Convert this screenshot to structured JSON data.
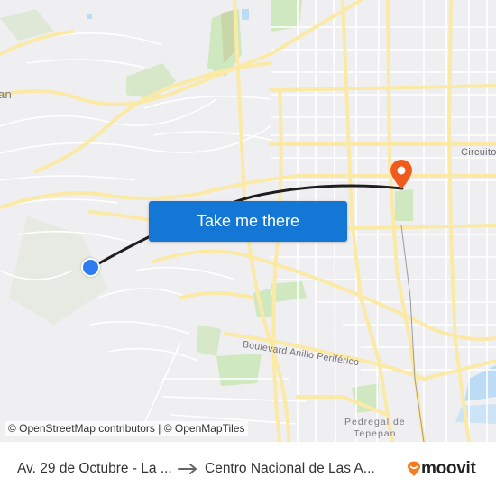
{
  "map": {
    "labels": {
      "circuito": "Circuito",
      "periferico": "Boulevard Anillo Periférico",
      "pedregal_line1": "Pedregal de",
      "pedregal_line2": "Tepepan",
      "partial_place": "an"
    },
    "colors": {
      "background": "#efeff1",
      "road": "#fbe9a6",
      "minor_road": "#ffffff",
      "park": "#cfe8c0",
      "water": "#bcdcf5",
      "route": "#222222",
      "origin_dot": "#2f7bf0",
      "destination_pin": "#f05a1c",
      "button": "#1477d5"
    }
  },
  "cta": {
    "label": "Take me there"
  },
  "markers": {
    "origin_icon": "origin-dot",
    "destination_icon": "map-pin"
  },
  "attribution": {
    "osm": "© OpenStreetMap contributors",
    "separator": " | ",
    "omt": "© OpenMapTiles"
  },
  "footer": {
    "origin": "Av. 29 de Octubre - La ...",
    "arrow_icon": "arrow-right",
    "destination": "Centro Nacional de Las A...",
    "brand": "moovit"
  }
}
